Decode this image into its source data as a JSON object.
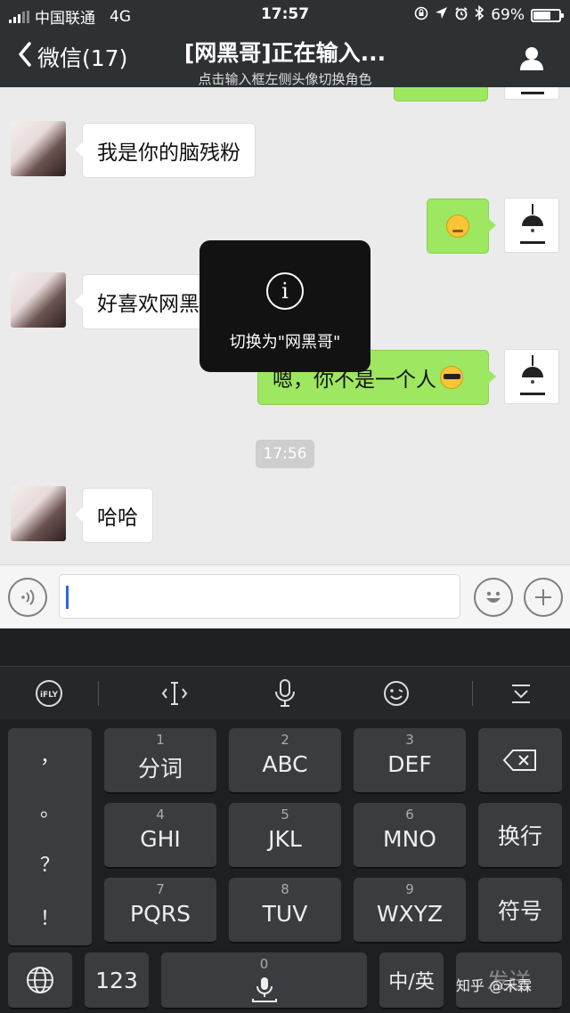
{
  "status_bar": {
    "carrier": "中国联通",
    "network": "4G",
    "time": "17:57",
    "battery": "69%",
    "battery_level": 0.69
  },
  "header": {
    "back_label": "微信(17)",
    "title": "[网黑哥]正在输入...",
    "subtitle": "点击输入框左侧头像切换角色"
  },
  "messages": [
    {
      "side": "left",
      "text": "我是你的脑残粉"
    },
    {
      "side": "right",
      "text": "",
      "emoji": "sly-face-emoji"
    },
    {
      "side": "left",
      "text": "好喜欢网黑"
    },
    {
      "side": "right",
      "text": "嗯，你不是一个人",
      "emoji": "sunglasses-emoji"
    },
    {
      "side": "left",
      "text": "哈哈"
    }
  ],
  "timestamp": "17:56",
  "toast": {
    "icon": "info-icon",
    "text": "切换为\"网黑哥\""
  },
  "input": {
    "value": ""
  },
  "keyboard": {
    "toolbar": [
      "ifly-logo-icon",
      "cursor-move-icon",
      "microphone-icon",
      "emoji-icon",
      "collapse-keyboard-icon"
    ],
    "punctuation": [
      "，",
      "。",
      "？",
      "！"
    ],
    "keys": [
      {
        "num": "1",
        "label": "分词"
      },
      {
        "num": "2",
        "label": "ABC"
      },
      {
        "num": "3",
        "label": "DEF"
      },
      {
        "num": "4",
        "label": "GHI"
      },
      {
        "num": "5",
        "label": "JKL"
      },
      {
        "num": "6",
        "label": "MNO"
      },
      {
        "num": "7",
        "label": "PQRS"
      },
      {
        "num": "8",
        "label": "TUV"
      },
      {
        "num": "9",
        "label": "WXYZ"
      }
    ],
    "switch_label": "换行",
    "symbol_label": "符号",
    "numeric_label": "123",
    "space_num": "0",
    "lang_label": "中/英",
    "send_label": "发送"
  },
  "watermark": "知乎 @禾霖"
}
